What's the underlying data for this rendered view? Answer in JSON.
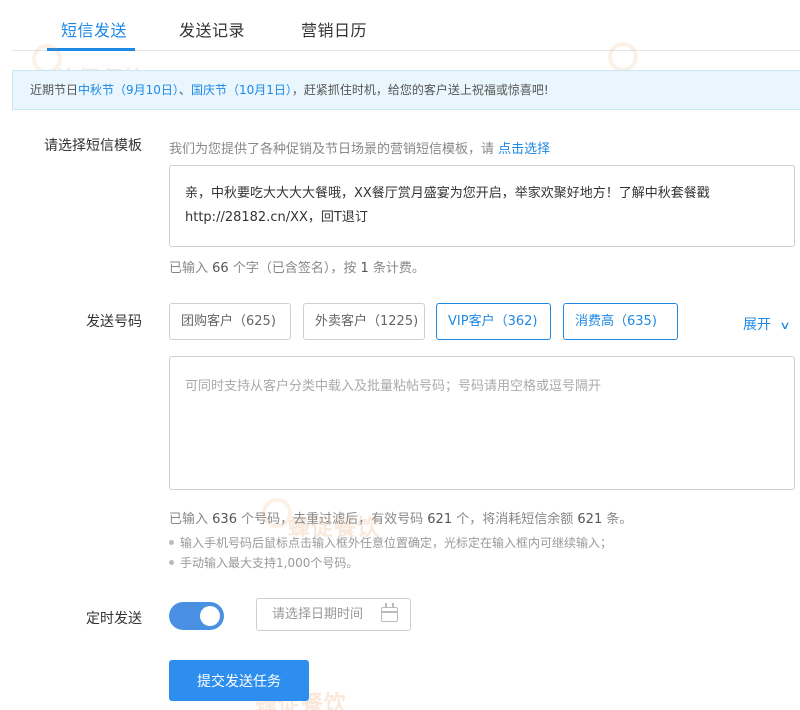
{
  "tabs": [
    {
      "label": "短信发送",
      "active": true
    },
    {
      "label": "发送记录",
      "active": false
    },
    {
      "label": "营销日历",
      "active": false
    }
  ],
  "watermark": "蜂促餐饮",
  "notice": {
    "prefix": "近期节日",
    "holiday1": "中秋节（9月10日）",
    "sep": "、",
    "holiday2": "国庆节（10月1日）",
    "suffix": "，赶紧抓住时机，给您的客户送上祝福或惊喜吧!"
  },
  "template": {
    "label": "请选择短信模板",
    "hint": "我们为您提供了各种促销及节日场景的营销短信模板，请",
    "link": "点击选择",
    "content": "亲，中秋要吃大大大大餐哦，XX餐厅赏月盛宴为您开启，举家欢聚好地方！了解中秋套餐戳http://28182.cn/XX，回T退订",
    "count_prefix": "已输入",
    "count_chars": "66",
    "count_mid": "个字（已含签名），按",
    "count_msgs": "1",
    "count_suffix": "条计费。"
  },
  "numbers": {
    "label": "发送号码",
    "groups": [
      {
        "label": "团购客户（625)",
        "selected": false
      },
      {
        "label": "外卖客户（1225)",
        "selected": false
      },
      {
        "label": "VIP客户（362)",
        "selected": true
      },
      {
        "label": "消费高（635)",
        "selected": true
      }
    ],
    "expand": "展开",
    "placeholder": "可同时支持从客户分类中载入及批量粘帖号码；号码请用空格或逗号隔开",
    "stats_a": "已输入",
    "stats_input": "636",
    "stats_b": "个号码，去重过滤后，有效号码",
    "stats_valid": "621",
    "stats_c": "个，将消耗短信余额",
    "stats_cost": "621",
    "stats_d": "条。",
    "tips": [
      "输入手机号码后鼠标点击输入框外任意位置确定，光标定在输入框内可继续输入；",
      "手动输入最大支持1,000个号码。"
    ]
  },
  "schedule": {
    "label": "定时发送",
    "enabled": true,
    "date_placeholder": "请选择日期时间"
  },
  "submit_label": "提交发送任务",
  "colors": {
    "accent": "#1e88e5",
    "notice_bg": "#e9f6fd",
    "toggle_on": "#4a90e2"
  }
}
